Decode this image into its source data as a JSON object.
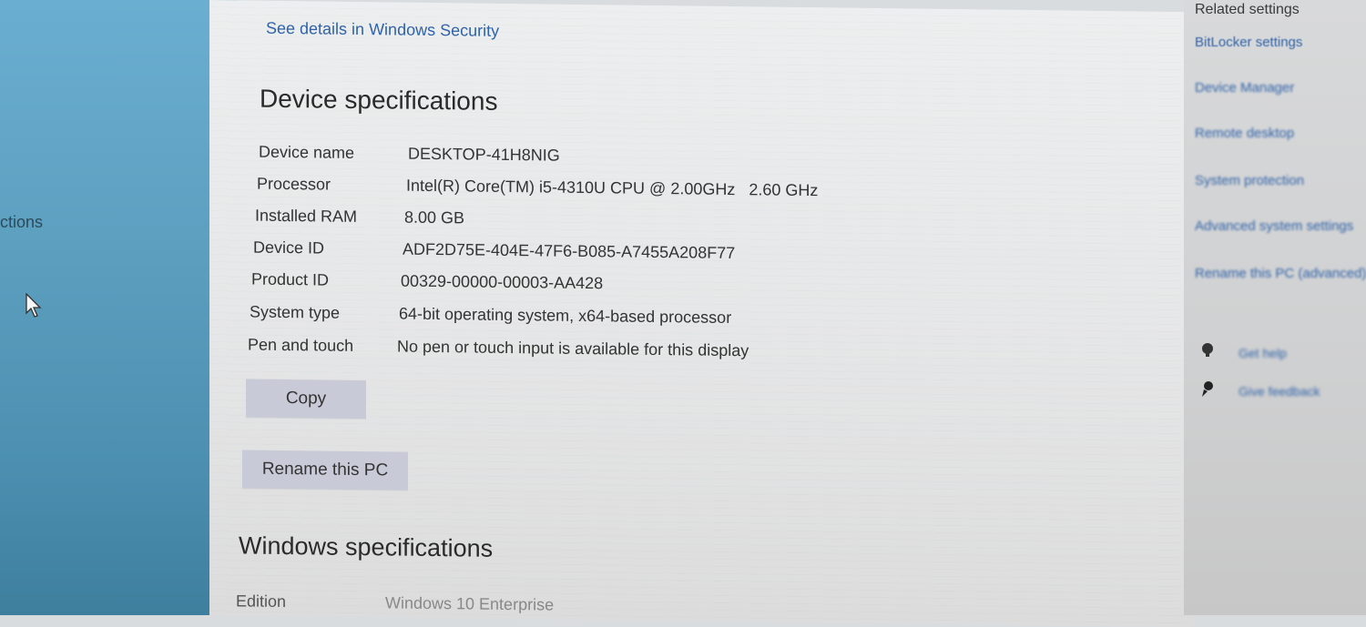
{
  "left_panel": {
    "truncated_label": "ctions"
  },
  "security": {
    "link": "See details in Windows Security"
  },
  "device_specs": {
    "heading": "Device specifications",
    "rows": [
      {
        "key": "Device name",
        "value": "DESKTOP-41H8NIG"
      },
      {
        "key": "Processor",
        "value": "Intel(R) Core(TM) i5-4310U CPU @ 2.00GHz   2.60 GHz"
      },
      {
        "key": "Installed RAM",
        "value": "8.00 GB"
      },
      {
        "key": "Device ID",
        "value": "ADF2D75E-404E-47F6-B085-A7455A208F77"
      },
      {
        "key": "Product ID",
        "value": "00329-00000-00003-AA428"
      },
      {
        "key": "System type",
        "value": "64-bit operating system, x64-based processor"
      },
      {
        "key": "Pen and touch",
        "value": "No pen or touch input is available for this display"
      }
    ],
    "copy_label": "Copy",
    "rename_label": "Rename this PC"
  },
  "windows_specs": {
    "heading": "Windows specifications",
    "rows": [
      {
        "key": "Edition",
        "value": "Windows 10 Enterprise"
      }
    ]
  },
  "related_settings": {
    "heading": "Related settings",
    "links": [
      "BitLocker settings",
      "Device Manager",
      "Remote desktop",
      "System protection",
      "Advanced system settings",
      "Rename this PC (advanced)"
    ],
    "help": [
      {
        "label": "Get help",
        "icon": "help-icon"
      },
      {
        "label": "Give feedback",
        "icon": "feedback-icon"
      }
    ]
  },
  "colors": {
    "link": "#2f62a8",
    "button": "#c9cad8",
    "left_strip": "#5d9fbf"
  }
}
